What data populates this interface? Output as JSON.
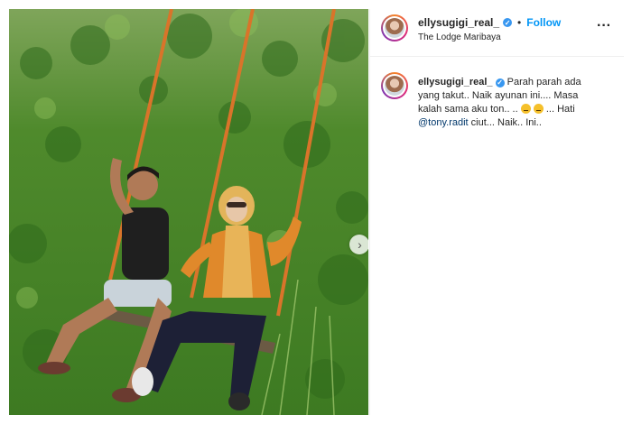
{
  "post": {
    "username": "ellysugigi_real_",
    "verified_label": "✓",
    "separator": "•",
    "follow_label": "Follow",
    "location": "The Lodge Maribaya",
    "more_label": "···",
    "next_label": "›"
  },
  "caption": {
    "username": "ellysugigi_real_",
    "text_part1": "Parah parah ada yang takut.. Naik ayunan ini.... Masa kalah sama aku ton.. .. ",
    "text_part2": "... Hati ",
    "mention": "@tony.radit",
    "text_part3": " ciut... Naik.. Ini.."
  },
  "icons": {
    "verified": "verified-badge-icon",
    "more": "more-options-icon",
    "next": "chevron-right-icon",
    "emoji": "unamused-face-icon"
  },
  "colors": {
    "accent": "#0095f6",
    "mention": "#00376b",
    "verified": "#3897f0"
  }
}
